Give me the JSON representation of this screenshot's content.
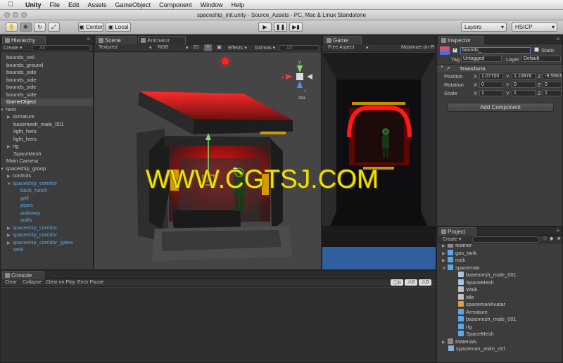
{
  "menubar": {
    "items": [
      "Unity",
      "File",
      "Edit",
      "Assets",
      "GameObject",
      "Component",
      "Window",
      "Help"
    ]
  },
  "window_title": "spaceship_init.unity - Source_Assets - PC, Mac & Linux Standalone",
  "toolbar": {
    "pivot": "Center",
    "space": "Local",
    "layers": "Layers",
    "layout": "HSICP"
  },
  "hierarchy": {
    "tab": "Hierarchy",
    "create": "Create",
    "search": "All",
    "items": [
      {
        "label": "bounds_ceil",
        "indent": 0
      },
      {
        "label": "bounds_ground",
        "indent": 0
      },
      {
        "label": "bounds_side",
        "indent": 0
      },
      {
        "label": "bounds_side",
        "indent": 0
      },
      {
        "label": "bounds_side",
        "indent": 0
      },
      {
        "label": "bounds_side",
        "indent": 0
      },
      {
        "label": "GameObject",
        "indent": 0,
        "selected": true
      },
      {
        "label": "hero",
        "indent": 0,
        "open": true
      },
      {
        "label": "Armature",
        "indent": 1,
        "arrow": true
      },
      {
        "label": "basemesh_male_001",
        "indent": 1
      },
      {
        "label": "light_hero",
        "indent": 1
      },
      {
        "label": "light_hero",
        "indent": 1
      },
      {
        "label": "rig",
        "indent": 1,
        "arrow": true
      },
      {
        "label": "SpaceMesh",
        "indent": 1
      },
      {
        "label": "Main Camera",
        "indent": 0
      },
      {
        "label": "spaceship_group",
        "indent": 0,
        "open": true
      },
      {
        "label": "controls",
        "indent": 1,
        "arrow": true
      },
      {
        "label": "spaceship_corridor",
        "indent": 1,
        "open": true,
        "blue": true
      },
      {
        "label": "back_hatch",
        "indent": 2,
        "blue": true
      },
      {
        "label": "grill",
        "indent": 2,
        "blue": true
      },
      {
        "label": "pipes",
        "indent": 2,
        "blue": true
      },
      {
        "label": "walkway",
        "indent": 2,
        "blue": true
      },
      {
        "label": "walls",
        "indent": 2,
        "blue": true
      },
      {
        "label": "spaceship_corridor",
        "indent": 1,
        "arrow": true,
        "blue": true
      },
      {
        "label": "spaceship_corridor",
        "indent": 1,
        "arrow": true,
        "blue": true
      },
      {
        "label": "spaceship_corridor_gates",
        "indent": 1,
        "arrow": true,
        "blue": true
      },
      {
        "label": "tank",
        "indent": 1,
        "blue": true
      }
    ]
  },
  "scene": {
    "tab": "Scene",
    "tab2": "Animator",
    "shading": "Textured",
    "render": "RGB",
    "mode": "2D",
    "effects": "Effects",
    "gizmos": "Gizmos",
    "search": "All",
    "gizmo_label": "Iso",
    "axes": {
      "x": "x",
      "y": "y",
      "z": "z"
    }
  },
  "game": {
    "tab": "Game",
    "aspect": "Free Aspect",
    "maximize": "Maximize on Pl"
  },
  "inspector": {
    "tab": "Inspector",
    "object_name": "bounds_",
    "static_label": "Static",
    "tag_label": "Tag",
    "tag_value": "Untagged",
    "layer_label": "Layer",
    "layer_value": "Default",
    "component": "Transform",
    "rows": [
      {
        "label": "Position",
        "x": "1.07700",
        "y": "1.10878",
        "z": "-9.5983"
      },
      {
        "label": "Rotation",
        "x": "0",
        "y": "0",
        "z": "0"
      },
      {
        "label": "Scale",
        "x": "1",
        "y": "1",
        "z": "1"
      }
    ],
    "axis_x": "X",
    "axis_y": "Y",
    "axis_z": "Z",
    "add_component": "Add Component"
  },
  "console": {
    "tab": "Console",
    "buttons": [
      "Clear",
      "Collapse",
      "Clear on Play",
      "Error Pause"
    ],
    "counts": [
      "0",
      "0",
      "0"
    ]
  },
  "project": {
    "tab": "Project",
    "create": "Create",
    "items": [
      {
        "label": "feather",
        "indent": 0,
        "arrow": true,
        "icon": "folder"
      },
      {
        "label": "gas_tank",
        "indent": 0,
        "arrow": true,
        "icon": "prefab"
      },
      {
        "label": "rock",
        "indent": 0,
        "arrow": true,
        "icon": "prefab"
      },
      {
        "label": "spaceman",
        "indent": 0,
        "open": true,
        "icon": "prefab"
      },
      {
        "label": "basemesh_male_001",
        "indent": 1,
        "icon": "mesh"
      },
      {
        "label": "SpaceMesh",
        "indent": 1,
        "icon": "mesh"
      },
      {
        "label": "Walk",
        "indent": 1,
        "icon": "anim"
      },
      {
        "label": "idle",
        "indent": 1,
        "icon": "anim"
      },
      {
        "label": "spacemanAvatar",
        "indent": 1,
        "icon": "avatar"
      },
      {
        "label": "Armature",
        "indent": 1,
        "icon": "prefab"
      },
      {
        "label": "basemesh_male_001",
        "indent": 1,
        "icon": "prefab"
      },
      {
        "label": "rig",
        "indent": 1,
        "icon": "prefab"
      },
      {
        "label": "SpaceMesh",
        "indent": 1,
        "icon": "prefab"
      },
      {
        "label": "Materials",
        "indent": 0,
        "arrow": true,
        "icon": "folder"
      },
      {
        "label": "spaceman_anim_ctrl",
        "indent": 0,
        "icon": "controller"
      }
    ]
  },
  "watermark": "WWW.CGTSJ.COM",
  "colors": {
    "accent_blue": "#5fa7e8",
    "watermark_yellow": "#f1e100",
    "corridor_red": "#ff1a1a"
  }
}
